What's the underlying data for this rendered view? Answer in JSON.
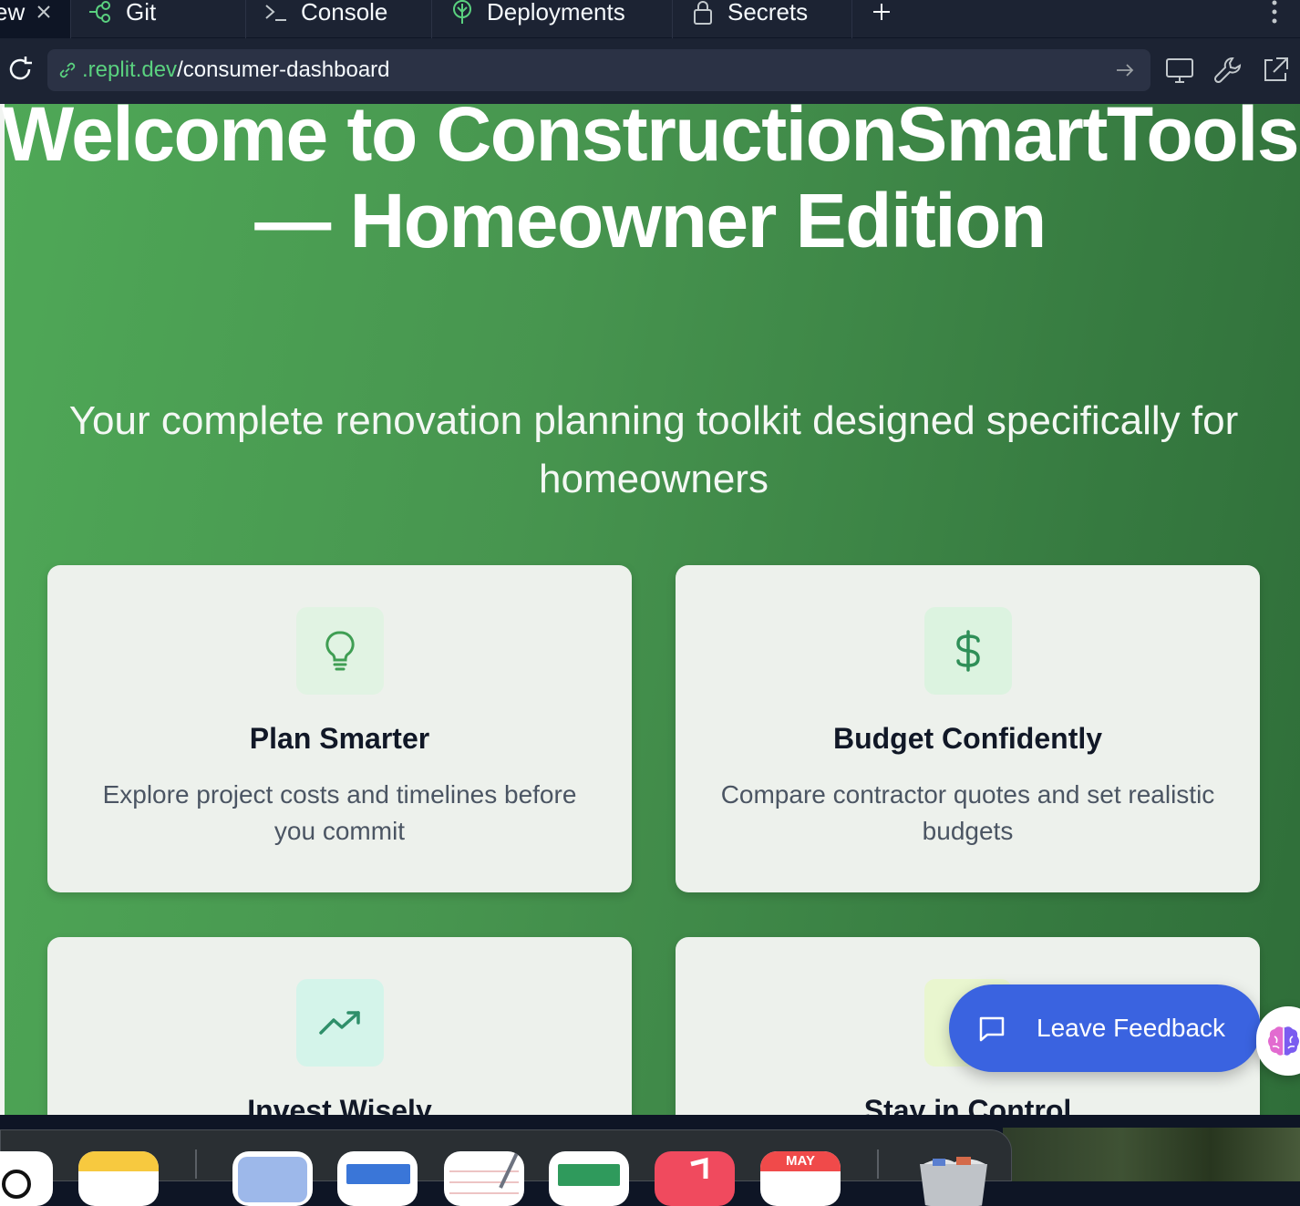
{
  "tabs": {
    "first_label": "ew",
    "git": "Git",
    "console": "Console",
    "deployments": "Deployments",
    "secrets": "Secrets"
  },
  "address": {
    "host": ".replit.dev",
    "path": "/consumer-dashboard"
  },
  "hero": {
    "title": "Welcome to ConstructionSmartTools — Homeowner Edition",
    "subtitle": "Your complete renovation planning toolkit designed specifically for homeowners"
  },
  "cards": [
    {
      "title": "Plan Smarter",
      "description": "Explore project costs and timelines before you commit",
      "icon": "lightbulb-icon"
    },
    {
      "title": "Budget Confidently",
      "description": "Compare contractor quotes and set realistic budgets",
      "icon": "dollar-icon"
    },
    {
      "title": "Invest Wisely",
      "description": "",
      "icon": "trending-up-icon"
    },
    {
      "title": "Stay in Control",
      "description": "",
      "icon": "shield-icon"
    }
  ],
  "feedback": {
    "label": "Leave Feedback"
  },
  "dock": {
    "calendar_month": "MAY"
  },
  "colors": {
    "accent_green": "#4fa857",
    "feedback_blue": "#3a63e0",
    "ide_background": "#1c2333"
  }
}
